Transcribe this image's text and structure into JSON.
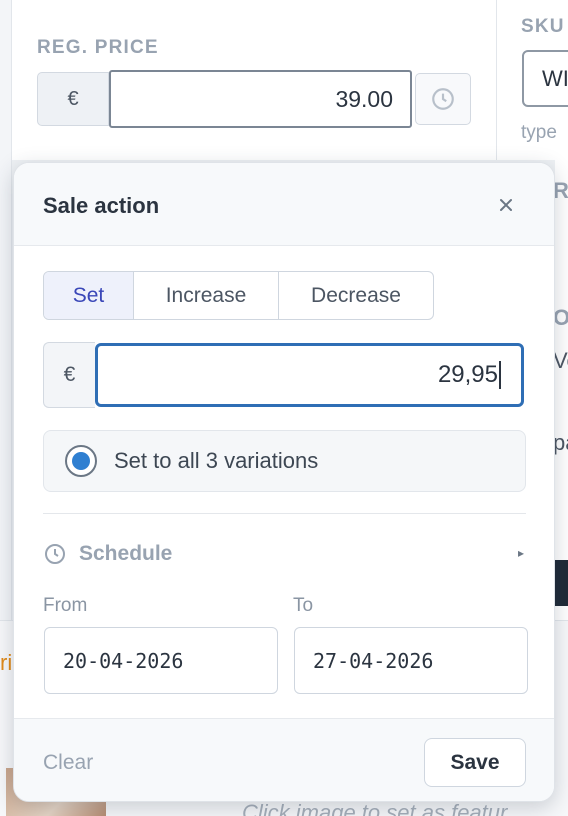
{
  "background": {
    "reg_price_label": "REG. PRICE",
    "reg_price_currency": "€",
    "reg_price_value": "39.00",
    "sku_label": "SKU",
    "sku_value": "WI",
    "sku_hint": "type",
    "peek_letters": [
      "R",
      "O",
      "Ve",
      "pa"
    ],
    "orange_fragment": "ri",
    "caption": "Click image to set as featur"
  },
  "popover": {
    "title": "Sale action",
    "close_glyph": "×",
    "modes": [
      {
        "label": "Set",
        "active": true
      },
      {
        "label": "Increase",
        "active": false
      },
      {
        "label": "Decrease",
        "active": false
      }
    ],
    "currency": "€",
    "amount_value": "29,95",
    "apply_option": {
      "label": "Set to all 3 variations",
      "selected": true
    },
    "schedule": {
      "label": "Schedule",
      "icon": "clock-icon",
      "arrow": "▸"
    },
    "from": {
      "label": "From",
      "value": "20-04-2026"
    },
    "to": {
      "label": "To",
      "value": "27-04-2026"
    },
    "clear_label": "Clear",
    "save_label": "Save"
  },
  "colors": {
    "accent": "#2f6eb5",
    "active_segment_text": "#3a47b8",
    "radio_fill": "#2f7fd1"
  }
}
